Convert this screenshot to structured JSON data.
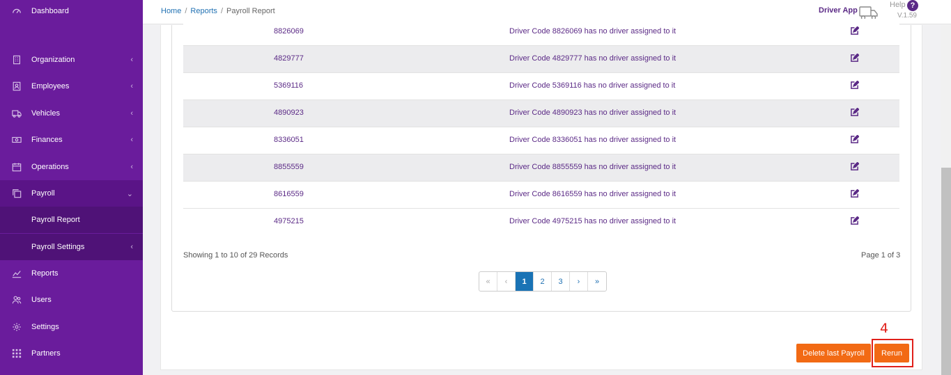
{
  "sidebar": {
    "items": [
      {
        "label": "Dashboard",
        "icon": "dashboard-icon",
        "chevron": ""
      },
      {
        "label": "Organization",
        "icon": "building-icon",
        "chevron": "‹"
      },
      {
        "label": "Employees",
        "icon": "id-card-icon",
        "chevron": "‹"
      },
      {
        "label": "Vehicles",
        "icon": "truck-icon",
        "chevron": "‹"
      },
      {
        "label": "Finances",
        "icon": "money-icon",
        "chevron": "‹"
      },
      {
        "label": "Operations",
        "icon": "calendar-icon",
        "chevron": "‹"
      },
      {
        "label": "Payroll",
        "icon": "copy-icon",
        "chevron": "⌄"
      },
      {
        "label": "Reports",
        "icon": "chart-line-icon",
        "chevron": ""
      },
      {
        "label": "Users",
        "icon": "users-icon",
        "chevron": ""
      },
      {
        "label": "Settings",
        "icon": "gear-icon",
        "chevron": ""
      },
      {
        "label": "Partners",
        "icon": "grid-icon",
        "chevron": ""
      }
    ],
    "sub_items": [
      {
        "label": "Payroll Report",
        "chevron": ""
      },
      {
        "label": "Payroll Settings",
        "chevron": "‹"
      }
    ]
  },
  "header": {
    "breadcrumb": [
      "Home",
      "Reports",
      "Payroll Report"
    ],
    "driver_app": "Driver App",
    "help": "Help",
    "help_icon": "?",
    "version": "V.1.59"
  },
  "table": {
    "rows": [
      {
        "code": "8826069",
        "message": "Driver Code 8826069 has no driver assigned to it"
      },
      {
        "code": "4829777",
        "message": "Driver Code 4829777 has no driver assigned to it"
      },
      {
        "code": "5369116",
        "message": "Driver Code 5369116 has no driver assigned to it"
      },
      {
        "code": "4890923",
        "message": "Driver Code 4890923 has no driver assigned to it"
      },
      {
        "code": "8336051",
        "message": "Driver Code 8336051 has no driver assigned to it"
      },
      {
        "code": "8855559",
        "message": "Driver Code 8855559 has no driver assigned to it"
      },
      {
        "code": "8616559",
        "message": "Driver Code 8616559 has no driver assigned to it"
      },
      {
        "code": "4975215",
        "message": "Driver Code 4975215 has no driver assigned to it"
      }
    ],
    "row_action_icon": "edit-icon"
  },
  "footer": {
    "showing": "Showing 1 to 10 of 29 Records",
    "page_info": "Page 1 of 3"
  },
  "pagination": {
    "first": "«",
    "prev": "‹",
    "pages": [
      "1",
      "2",
      "3"
    ],
    "current": "1",
    "next": "›",
    "last": "»"
  },
  "actions": {
    "delete_label": "Delete last Payroll",
    "rerun_label": "Rerun",
    "step_annotation": "4"
  },
  "colors": {
    "sidebar": "#6a1c9c",
    "accent": "#f26a14",
    "link": "#2272b3",
    "highlight": "#e0201b"
  }
}
